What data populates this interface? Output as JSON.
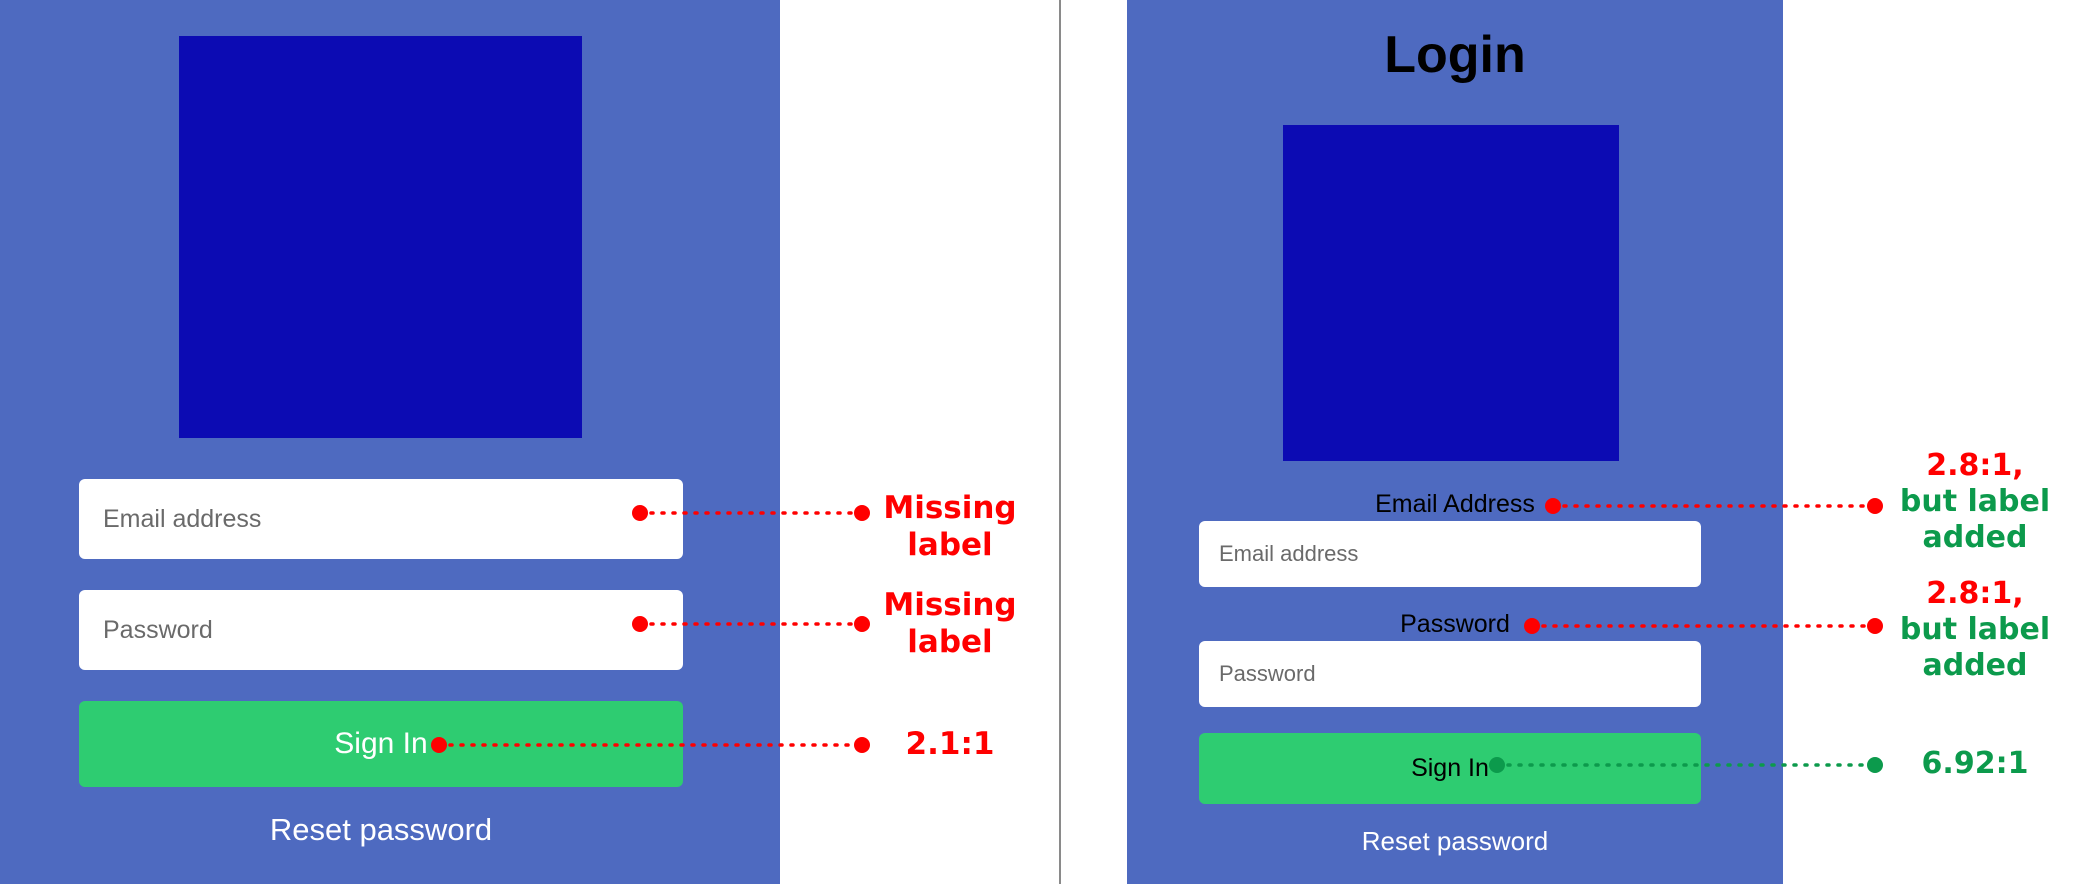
{
  "left": {
    "email_placeholder": "Email address",
    "password_placeholder": "Password",
    "sign_in_label": "Sign In",
    "reset_label": "Reset password"
  },
  "right": {
    "title": "Login",
    "email_label": "Email Address",
    "email_placeholder": "Email address",
    "password_label": "Password",
    "password_placeholder": "Password",
    "sign_in_label": "Sign In",
    "reset_label": "Reset password"
  },
  "annotations": {
    "left_email_line1": "Missing",
    "left_email_line2": "label",
    "left_password_line1": "Missing",
    "left_password_line2": "label",
    "left_button": "2.1:1",
    "right_email_line1": "2.8:1,",
    "right_email_line2": "but label",
    "right_email_line3": "added",
    "right_password_line1": "2.8:1,",
    "right_password_line2": "but label",
    "right_password_line3": "added",
    "right_button": "6.92:1"
  },
  "colors": {
    "panel": "#4e6ac0",
    "logo": "#0c0bb3",
    "button": "#2ecc71",
    "fail": "#ff0000",
    "pass": "#0c9a4c"
  }
}
